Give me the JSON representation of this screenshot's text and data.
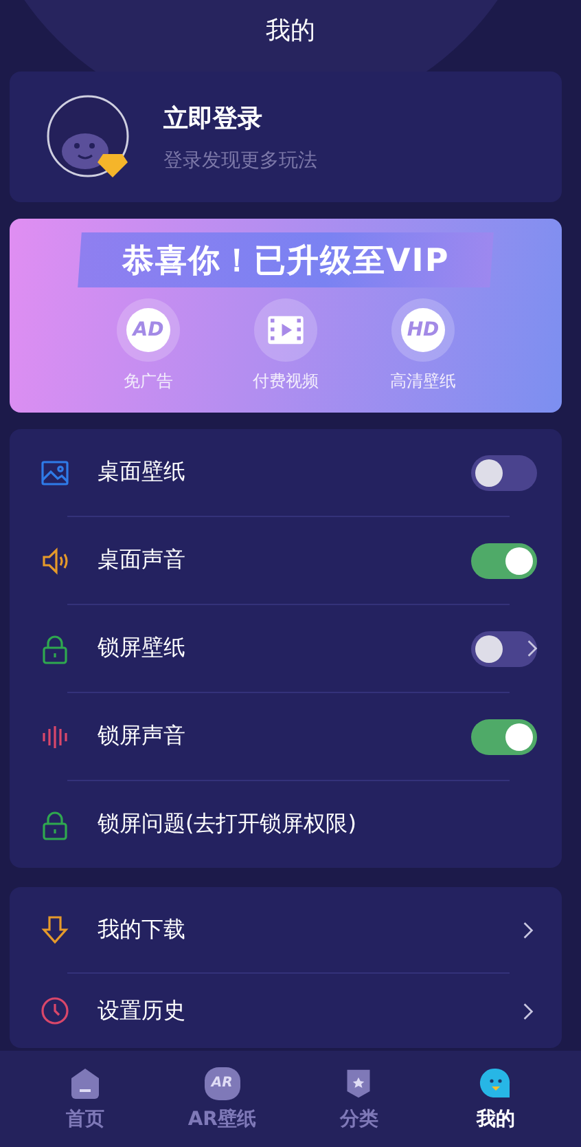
{
  "header": {
    "title": "我的"
  },
  "profile": {
    "name": "立即登录",
    "subtitle": "登录发现更多玩法"
  },
  "vip": {
    "banner": "恭喜你！已升级至VIP",
    "perks": [
      {
        "kind": "ad",
        "icon_text": "AD",
        "label": "免广告"
      },
      {
        "kind": "video",
        "label": "付费视频"
      },
      {
        "kind": "hd",
        "icon_text": "HD",
        "label": "高清壁纸"
      }
    ]
  },
  "settings": [
    {
      "kind": "toggle",
      "label": "桌面壁纸",
      "on": false
    },
    {
      "kind": "toggle",
      "label": "桌面声音",
      "on": true
    },
    {
      "kind": "toggle",
      "label": "锁屏壁纸",
      "on": false,
      "chevron": true
    },
    {
      "kind": "toggle",
      "label": "锁屏声音",
      "on": true
    },
    {
      "kind": "link",
      "label": "锁屏问题(去打开锁屏权限)"
    }
  ],
  "menu": [
    {
      "label": "我的下载"
    },
    {
      "label": "设置历史"
    }
  ],
  "tabs": [
    {
      "kind": "home",
      "label": "首页",
      "selected": false
    },
    {
      "kind": "ar",
      "icon_text": "AR",
      "label": "AR壁纸",
      "selected": false
    },
    {
      "kind": "category",
      "label": "分类",
      "selected": false
    },
    {
      "kind": "profile",
      "label": "我的",
      "selected": true
    }
  ]
}
